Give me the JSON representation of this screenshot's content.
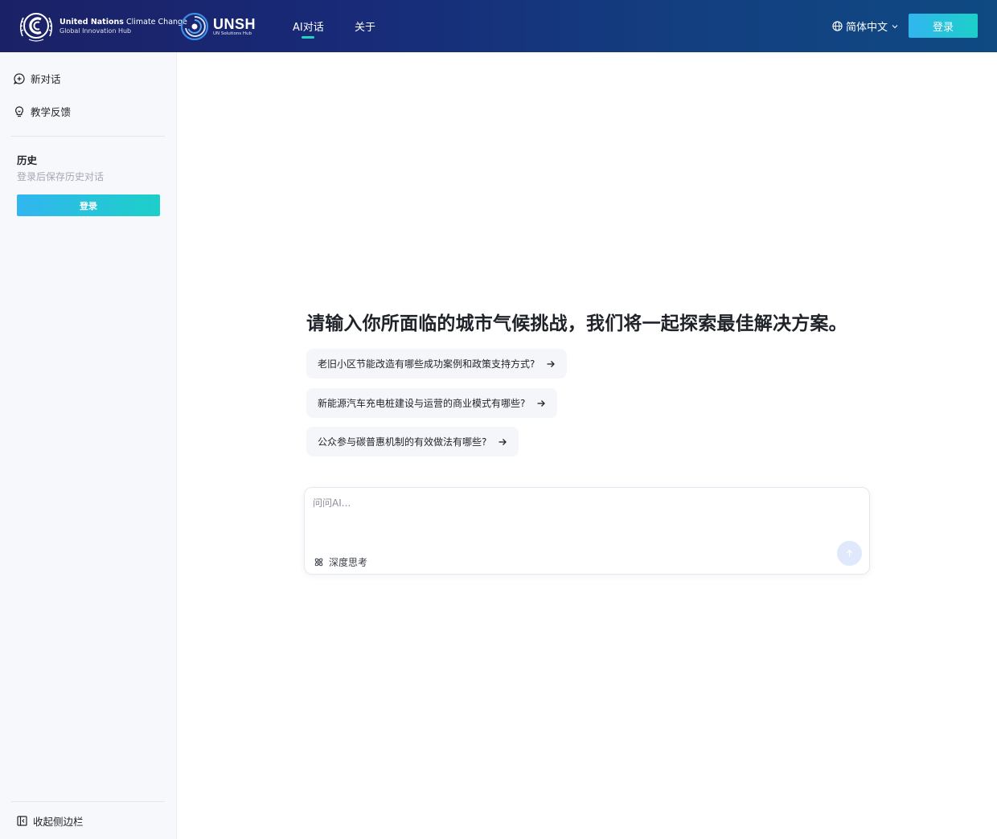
{
  "brand": {
    "unfccc_name_bold": "United Nations",
    "unfccc_name_thin": " Climate Change",
    "unfccc_subtitle": "Global Innovation Hub",
    "unsh_name": "UNSH",
    "unsh_subtitle": "UN Solutions Hub"
  },
  "nav": {
    "tabs": [
      {
        "label": "AI对话",
        "active": true
      },
      {
        "label": "关于",
        "active": false
      }
    ]
  },
  "header": {
    "language": "简体中文",
    "language_icon": "globe-icon",
    "login_label": "登录"
  },
  "sidebar": {
    "items": [
      {
        "label": "新对话",
        "icon": "chat-plus-icon"
      },
      {
        "label": "教学反馈",
        "icon": "lightbulb-icon"
      }
    ],
    "history_title": "历史",
    "history_hint": "登录后保存历史对话",
    "login_label": "登录",
    "collapse_label": "收起侧边栏",
    "collapse_icon": "collapse-sidebar-icon"
  },
  "main": {
    "headline": "请输入你所面临的城市气候挑战，我们将一起探索最佳解决方案。",
    "suggestions": [
      "老旧小区节能改造有哪些成功案例和政策支持方式?",
      "新能源汽车充电桩建设与运营的商业模式有哪些?",
      "公众参与碳普惠机制的有效做法有哪些?"
    ],
    "input_placeholder": "问问AI...",
    "deep_think_label": "深度思考",
    "deep_think_icon": "atom-icon",
    "send_icon": "arrow-up-icon"
  },
  "colors": {
    "header_gradient_start": "#1b2166",
    "header_gradient_end": "#0f4a83",
    "accent_start": "#31b6ef",
    "accent_end": "#1ccfc8",
    "tab_indicator": "#20d3c2"
  }
}
